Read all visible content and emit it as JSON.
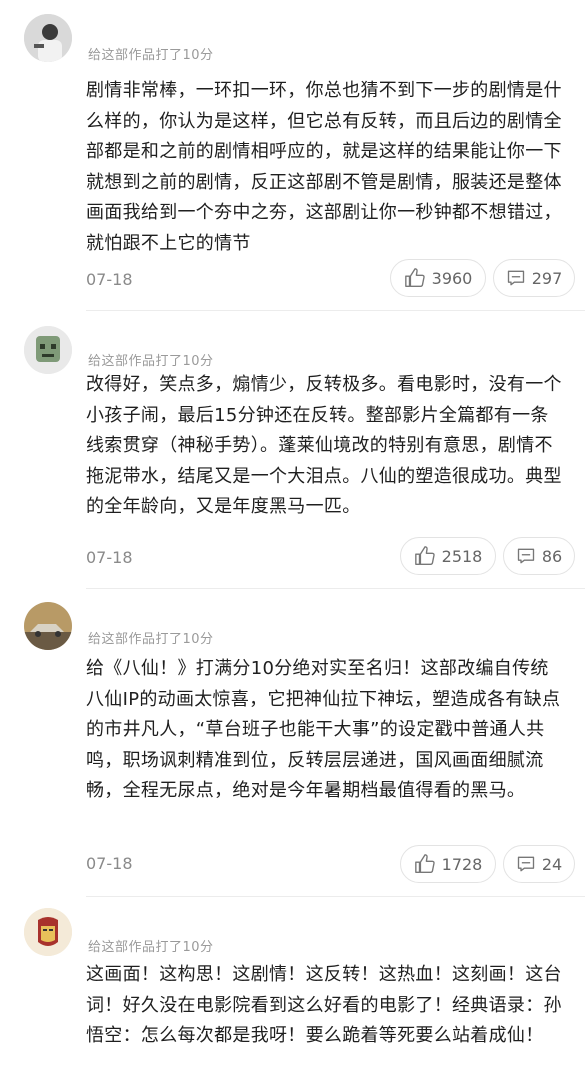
{
  "comments": [
    {
      "rating_text": "给这部作品打了10分",
      "text": "剧情非常棒，一环扣一环，你总也猜不到下一步的剧情是什么样的，你认为是这样，但它总有反转，而且后边的剧情全部都是和之前的剧情相呼应的，就是这样的结果能让你一下就想到之前的剧情，反正这部剧不管是剧情，服装还是整体画面我给到一个夯中之夯，这部剧让你一秒钟都不想错过，就怕跟不上它的情节",
      "date": "07-18",
      "likes": "3960",
      "replies": "297",
      "avatar_icon": "user-avatar-photo"
    },
    {
      "rating_text": "给这部作品打了10分",
      "text": "改得好，笑点多，煽情少，反转极多。看电影时，没有一个小孩子闹，最后15分钟还在反转。整部影片全篇都有一条线索贯穿（神秘手势）。蓬莱仙境改的特别有意思，剧情不拖泥带水，结尾又是一个大泪点。八仙的塑造很成功。典型的全年龄向，又是年度黑马一匹。",
      "date": "07-18",
      "likes": "2518",
      "replies": "86",
      "avatar_icon": "green-robot-avatar"
    },
    {
      "rating_text": "给这部作品打了10分",
      "text": "给《八仙！》打满分10分绝对实至名归！这部改编自传统八仙IP的动画太惊喜，它把神仙拉下神坛，塑造成各有缺点的市井凡人，“草台班子也能干大事”的设定戳中普通人共鸣，职场讽刺精准到位，反转层层递进，国风画面细腻流畅，全程无尿点，绝对是今年暑期档最值得看的黑马。",
      "date": "07-18",
      "likes": "1728",
      "replies": "24",
      "avatar_icon": "car-photo-avatar"
    },
    {
      "rating_text": "给这部作品打了10分",
      "text": "这画面！这构思！这剧情！这反转！这热血！这刻画！这台词！好久没在电影院看到这么好看的电影了！经典语录：孙悟空：怎么每次都是我呀！要么跪着等死要么站着成仙！",
      "date": "",
      "likes": "",
      "replies": "",
      "avatar_icon": "iron-helmet-avatar"
    }
  ],
  "icons": {
    "like": "thumbs-up-icon",
    "reply": "comment-icon"
  }
}
